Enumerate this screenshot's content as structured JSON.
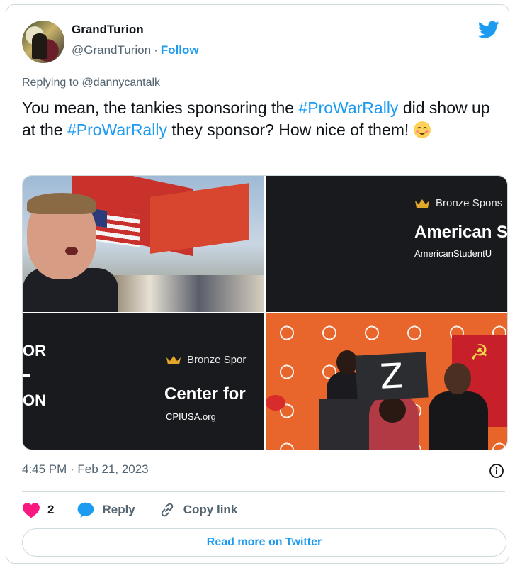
{
  "author": {
    "display_name": "GrandTurion",
    "handle": "@GrandTurion",
    "separator": "·",
    "follow_label": "Follow"
  },
  "reply": {
    "label": "Replying to @dannycantalk"
  },
  "tweet": {
    "text_1": "You mean, the tankies sponsoring the ",
    "hashtag_1": "#ProWarRally",
    "text_2": " did show up at the ",
    "hashtag_2": "#ProWarRally",
    "text_3": " they sponsor? How nice of them! ",
    "emoji": "smiling-face-with-smiling-eyes"
  },
  "media": {
    "tile2": {
      "sponsor_tier": "Bronze Spons",
      "org_name": "American S",
      "org_url": "AmericanStudentU"
    },
    "tile3": {
      "logo_line1": "OR",
      "logo_line2": "ON",
      "sponsor_tier": "Bronze Spor",
      "org_name": "Center for",
      "org_url": "CPIUSA.org"
    },
    "tile4": {
      "sign_letter": "Z"
    }
  },
  "meta": {
    "timestamp": "4:45 PM · Feb 21, 2023"
  },
  "actions": {
    "like_count": "2",
    "reply_label": "Reply",
    "copy_label": "Copy link",
    "read_more_label": "Read more on Twitter"
  },
  "colors": {
    "accent": "#1d9bf0",
    "heart": "#f91880",
    "muted": "#536471"
  }
}
